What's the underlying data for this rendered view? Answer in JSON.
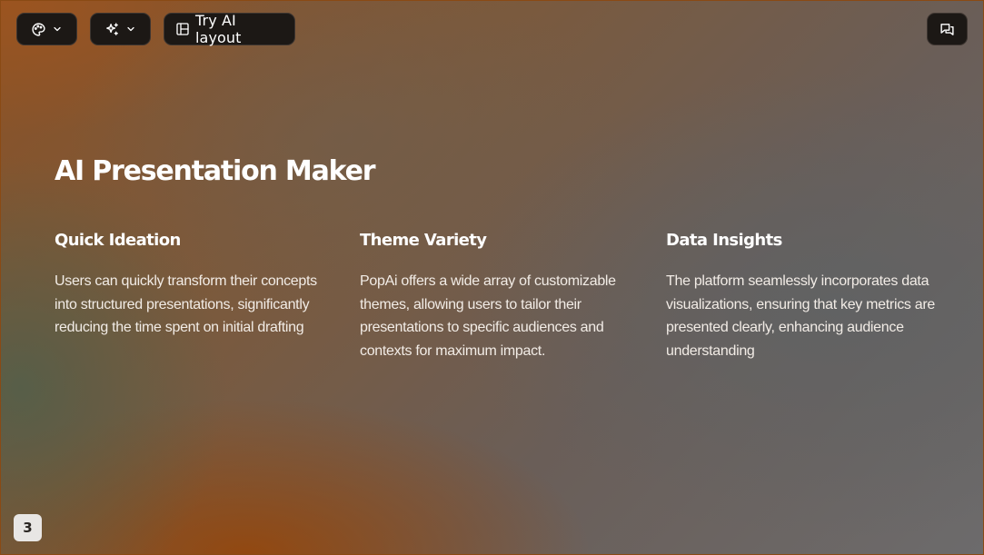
{
  "toolbar": {
    "theme_button": {
      "icon": "palette-icon",
      "dropdown_icon": "chevron-down-icon"
    },
    "magic_button": {
      "icon": "sparkles-icon",
      "dropdown_icon": "chevron-down-icon"
    },
    "layout_button": {
      "icon": "layout-icon",
      "label": "Try AI layout"
    },
    "chat_button": {
      "icon": "chat-icon"
    }
  },
  "slide": {
    "title": "AI Presentation Maker",
    "columns": [
      {
        "heading": "Quick Ideation",
        "body": "Users can quickly transform their concepts into structured presentations, significantly reducing the time spent on initial drafting"
      },
      {
        "heading": "Theme Variety",
        "body": "PopAi offers a wide array of customizable themes, allowing users to tailor their presentations to specific audiences and contexts for maximum impact."
      },
      {
        "heading": "Data Insights",
        "body": "The platform seamlessly incorporates data visualizations, ensuring that key metrics are presented clearly, enhancing audience understanding"
      }
    ]
  },
  "page_number": "3",
  "colors": {
    "button_bg": "#1c1815",
    "text": "#ffffff",
    "page_badge_bg": "#e8e6e4"
  }
}
